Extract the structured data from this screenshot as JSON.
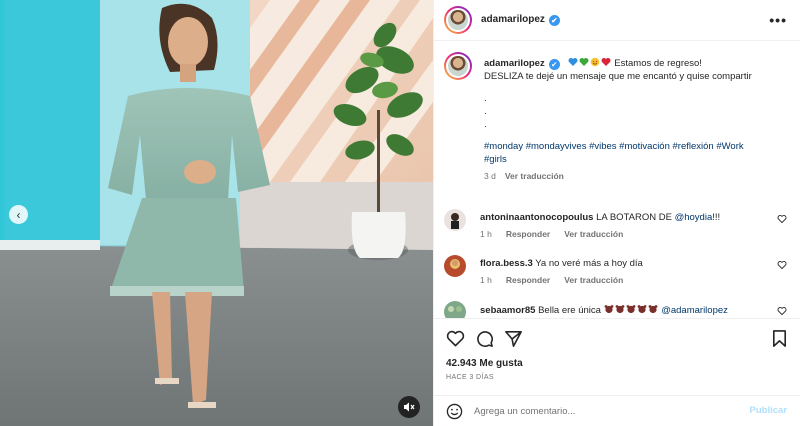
{
  "header": {
    "username": "adamarilopez",
    "verified_badge": "✔",
    "more_icon": "•••"
  },
  "caption": {
    "username": "adamarilopez",
    "verified_badge": "✔",
    "text_line1": "Estamos de regreso!",
    "text_line2": "DESLIZA te dejé un mensaje que me encantó y quise compartir",
    "dot1": ".",
    "dot2": ".",
    "dot3": ".",
    "hashtags_line1": "#monday #mondayvives #vibes #motivación #reflexión #Work",
    "hashtags_line2": "#girls",
    "time": "3 d",
    "translate": "Ver traducción",
    "emojis": [
      "blue-heart-icon",
      "green-heart-icon",
      "smiling-hearts-icon",
      "red-heart-icon"
    ]
  },
  "comments": [
    {
      "username": "antoninaantonocopoulus",
      "text_pre": "LA BOTARON DE ",
      "mention": "@hoydia",
      "text_post": "!!!",
      "time": "1 h",
      "reply": "Responder",
      "translate": "Ver traducción",
      "avatar_color": "#e9e2de"
    },
    {
      "username": "flora.bess.3",
      "text_pre": "Ya no veré más a hoy día",
      "mention": "",
      "text_post": "",
      "time": "1 h",
      "reply": "Responder",
      "translate": "Ver traducción",
      "avatar_color": "#b84b2e"
    },
    {
      "username": "sebaamor85",
      "text_pre": "Bella ere única ",
      "mention": "@adamarilopez",
      "text_post": "",
      "time": "",
      "reply": "",
      "translate": "",
      "avatar_color": "#7fa88a",
      "emojis": [
        "bear-icon",
        "bear-icon",
        "bear-icon",
        "bear-icon",
        "bear-icon"
      ]
    }
  ],
  "actions": {
    "likes": "42.943 Me gusta",
    "date": "HACE 3 DÍAS"
  },
  "add_comment": {
    "placeholder": "Agrega un comentario...",
    "post_label": "Publicar"
  },
  "media": {
    "prev_icon": "‹",
    "mute_icon": "muted-speaker-icon"
  },
  "colors": {
    "link": "#00376b",
    "verified": "#3897f0",
    "post_disabled": "#b2dffc",
    "secondary": "#737373"
  }
}
